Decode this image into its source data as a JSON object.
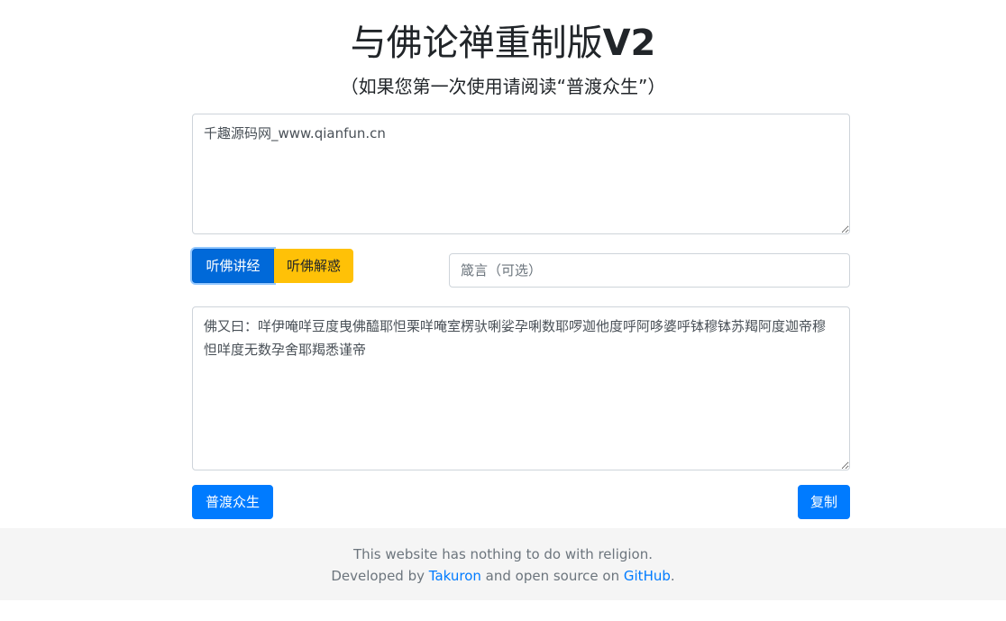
{
  "header": {
    "title_main": "与佛论禅重制版",
    "title_version": "V2",
    "subtitle": "（如果您第一次使用请阅读“普渡众生”）"
  },
  "input": {
    "value": "千趣源码网_www.qianfun.cn"
  },
  "actions": {
    "encode_label": "听佛讲经",
    "decode_label": "听佛解惑",
    "key_placeholder": "箴言（可选）"
  },
  "output": {
    "value": "佛又曰：咩伊唵咩豆度曳佛醯耶怛栗咩唵室楞驮唎娑孕唎数耶啰迦他度呼阿哆婆呼钵穆钵苏羯阿度迦帝穆怛咩度无数孕舍耶羯悉谨帝"
  },
  "bottom_buttons": {
    "help_label": "普渡众生",
    "copy_label": "复制"
  },
  "footer": {
    "line1": "This website has nothing to do with religion.",
    "line2_prefix": "Developed by ",
    "author_link": "Takuron",
    "line2_middle": " and open source on ",
    "github_link": "GitHub",
    "line2_suffix": "."
  },
  "colors": {
    "primary": "#007bff",
    "warning": "#ffc107",
    "footer_bg": "#f5f5f5"
  }
}
